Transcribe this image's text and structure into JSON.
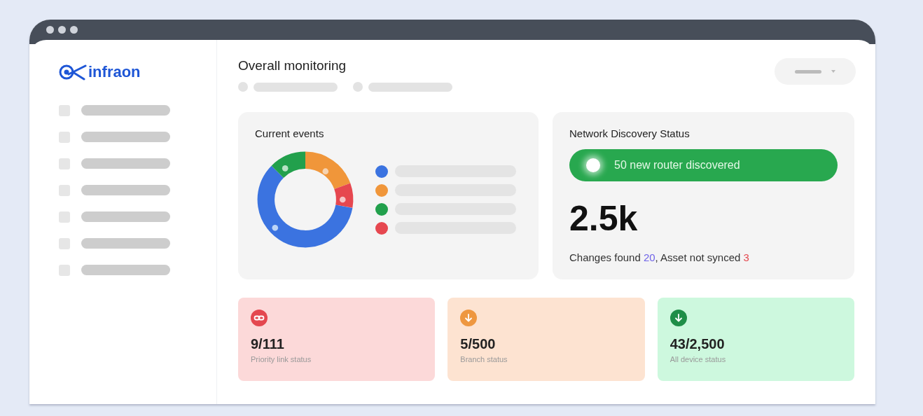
{
  "logo": {
    "text": "infraon"
  },
  "sidebar": {
    "items": [
      {
        "kind": "skeleton"
      },
      {
        "kind": "skeleton"
      },
      {
        "kind": "skeleton"
      },
      {
        "kind": "skeleton"
      },
      {
        "kind": "skeleton"
      },
      {
        "kind": "skeleton"
      },
      {
        "kind": "skeleton"
      }
    ]
  },
  "header": {
    "title": "Overall monitoring"
  },
  "events_card": {
    "title": "Current events",
    "legend": [
      {
        "color": "#3b73e0"
      },
      {
        "color": "#f0963a"
      },
      {
        "color": "#22a04c"
      },
      {
        "color": "#e6474f"
      }
    ]
  },
  "discovery_card": {
    "title": "Network Discovery Status",
    "banner": "50 new router discovered",
    "total": "2.5k",
    "summary": [
      {
        "text": "Changes found ",
        "kind": "plain"
      },
      {
        "text": "20",
        "kind": "count"
      },
      {
        "text": ", Asset not synced ",
        "kind": "plain"
      },
      {
        "text": "3",
        "kind": "alert"
      }
    ]
  },
  "stats": [
    {
      "kind": "link",
      "value": "9/111",
      "label": "Priority link status"
    },
    {
      "kind": "branch",
      "value": "5/500",
      "label": "Branch status"
    },
    {
      "kind": "device",
      "value": "43/2,500",
      "label": "All device status"
    }
  ]
}
